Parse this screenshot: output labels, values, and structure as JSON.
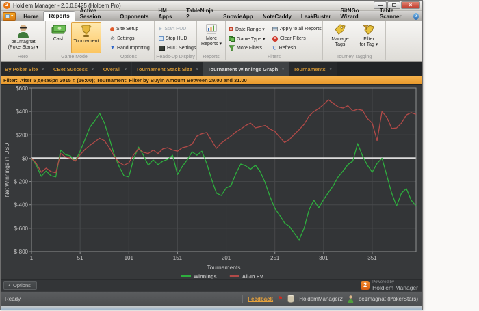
{
  "window": {
    "title": "Hold'em Manager - 2.0.0.8425 (Holdem Pro)",
    "badge": "2"
  },
  "icons": {
    "caret_down": "▾",
    "caret_up": "▴",
    "close": "×",
    "gear": "⚙",
    "down_arrow": "▼",
    "play": "▶",
    "refresh": "↻",
    "flag": "⚑",
    "help": "?",
    "dash": "–"
  },
  "menu": {
    "items": [
      "Home",
      "Reports",
      "Active Session",
      "Opponents",
      "HM Apps",
      "TableNinja 2",
      "SnowieApp",
      "NoteCaddy",
      "LeakBuster",
      "SitNGo Wizard",
      "Table Scanner"
    ]
  },
  "ribbon": {
    "hero": {
      "name": "be1magnat",
      "site": "(PokerStars) ▾",
      "group_label": "Hero"
    },
    "game_mode": {
      "cash": "Cash",
      "tournament": "Tournament",
      "group_label": "Game Mode"
    },
    "options": {
      "site_setup": "Site Setup",
      "settings": "Settings",
      "hand_importing": "Hand Importing",
      "group_label": "Options"
    },
    "hud": {
      "start": "Start HUD",
      "stop": "Stop HUD",
      "settings": "HUD Settings",
      "group_label": "Heads-Up Display"
    },
    "reports": {
      "more_line1": "More",
      "more_line2": "Reports ▾",
      "group_label": "Reports"
    },
    "filters": {
      "date_range": "Date Range ▾",
      "game_type": "Game Type ▾",
      "more_filters": "More Filters",
      "apply_all": "Apply to all Reports",
      "clear": "Clear Filters",
      "refresh": "Refresh",
      "group_label": "Filters"
    },
    "tagging": {
      "manage_line1": "Manage",
      "manage_line2": "Tags",
      "filter_line1": "Filter",
      "filter_line2": "for Tag ▾",
      "group_label": "Tourney Tagging"
    }
  },
  "tabs": {
    "items": [
      "By Poker Site",
      "CBet Success",
      "Overall",
      "Tournament Stack Size",
      "Tournament Winnings Graph",
      "Tournaments"
    ],
    "active_index": 4
  },
  "filter_bar": {
    "label": "Filter:",
    "text": "After 5 декабря 2015 г. (16:00); Tournament: Filter by Buyin Amount  Between 29.00 and 31.00"
  },
  "chart_footer": {
    "options": "Options",
    "powered_line1": "Powered by",
    "powered_line2": "Hold'em Manager",
    "badge": "2"
  },
  "statusbar": {
    "ready": "Ready",
    "feedback": "Feedback",
    "db": "HoldemManager2",
    "user": "be1magnat (PokerStars)"
  },
  "chart_data": {
    "type": "line",
    "xlabel": "Tournaments",
    "ylabel": "Net Winnings in USD",
    "xlim": [
      1,
      396
    ],
    "ylim": [
      -800,
      600
    ],
    "x_ticks": [
      1,
      51,
      101,
      151,
      201,
      251,
      301,
      351
    ],
    "y_ticks": [
      600,
      400,
      200,
      0,
      -200,
      -400,
      -600,
      -800
    ],
    "y_tick_labels": [
      "$600",
      "$400",
      "$200",
      "$0",
      "$-200",
      "$-400",
      "$-600",
      "$-800"
    ],
    "grid": true,
    "legend_position": "bottom",
    "zero_line": {
      "value": 0,
      "color": "#dcdcdc"
    },
    "colors": {
      "plot_bg": "#333537",
      "grid": "#47494b",
      "axis": "#8f9192",
      "tick_text": "#c3c3c3"
    },
    "x": [
      1,
      6,
      11,
      16,
      21,
      26,
      31,
      36,
      41,
      46,
      51,
      56,
      61,
      66,
      71,
      76,
      81,
      86,
      91,
      96,
      101,
      106,
      111,
      116,
      121,
      126,
      131,
      136,
      141,
      146,
      151,
      156,
      161,
      166,
      171,
      176,
      181,
      186,
      191,
      196,
      201,
      206,
      211,
      216,
      221,
      226,
      231,
      236,
      241,
      246,
      251,
      256,
      261,
      266,
      271,
      276,
      281,
      286,
      291,
      296,
      301,
      306,
      311,
      316,
      321,
      326,
      331,
      336,
      341,
      346,
      351,
      356,
      361,
      366,
      371,
      376,
      381,
      386,
      391,
      396
    ],
    "series": [
      {
        "name": "Winnings",
        "color": "#2eae3e",
        "values": [
          0,
          -60,
          -155,
          -110,
          -150,
          -160,
          70,
          30,
          20,
          -25,
          60,
          160,
          265,
          320,
          385,
          300,
          170,
          30,
          -70,
          -150,
          -160,
          -5,
          95,
          25,
          -60,
          -15,
          -55,
          -25,
          -10,
          25,
          -140,
          -70,
          -15,
          55,
          25,
          60,
          -45,
          -180,
          -300,
          -320,
          -255,
          -235,
          -130,
          -50,
          -65,
          -95,
          -60,
          -115,
          -210,
          -330,
          -430,
          -490,
          -555,
          -585,
          -645,
          -700,
          -600,
          -445,
          -360,
          -425,
          -355,
          -295,
          -235,
          -160,
          -110,
          -55,
          -25,
          125,
          20,
          -60,
          -120,
          -45,
          0,
          -150,
          -300,
          -410,
          -300,
          -260,
          -360,
          -410
        ]
      },
      {
        "name": "All-In EV",
        "color": "#b14a48",
        "values": [
          0,
          -45,
          -120,
          -85,
          -115,
          -125,
          40,
          10,
          0,
          -25,
          30,
          75,
          110,
          140,
          170,
          150,
          90,
          15,
          -35,
          -60,
          -40,
          30,
          80,
          50,
          40,
          70,
          40,
          80,
          90,
          70,
          60,
          90,
          100,
          120,
          190,
          210,
          220,
          150,
          85,
          130,
          160,
          190,
          225,
          250,
          280,
          300,
          260,
          270,
          280,
          250,
          230,
          180,
          135,
          160,
          205,
          245,
          290,
          360,
          400,
          425,
          460,
          500,
          470,
          440,
          430,
          450,
          405,
          420,
          410,
          340,
          300,
          150,
          400,
          350,
          255,
          260,
          300,
          370,
          390,
          375
        ]
      }
    ]
  }
}
